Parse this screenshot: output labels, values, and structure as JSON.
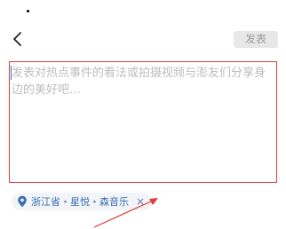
{
  "header": {
    "back_icon": "chevron-left-icon",
    "publish_label": "发表"
  },
  "editor": {
    "placeholder": "发表对热点事件的看法或拍摄视频与澎友们分享身边的美好吧…"
  },
  "location": {
    "icon": "location-pin-icon",
    "text": "浙江省・星悦・森音乐",
    "close_label": "×"
  },
  "colors": {
    "accent": "#3a6fb0",
    "annotation": "#e03a3a"
  }
}
